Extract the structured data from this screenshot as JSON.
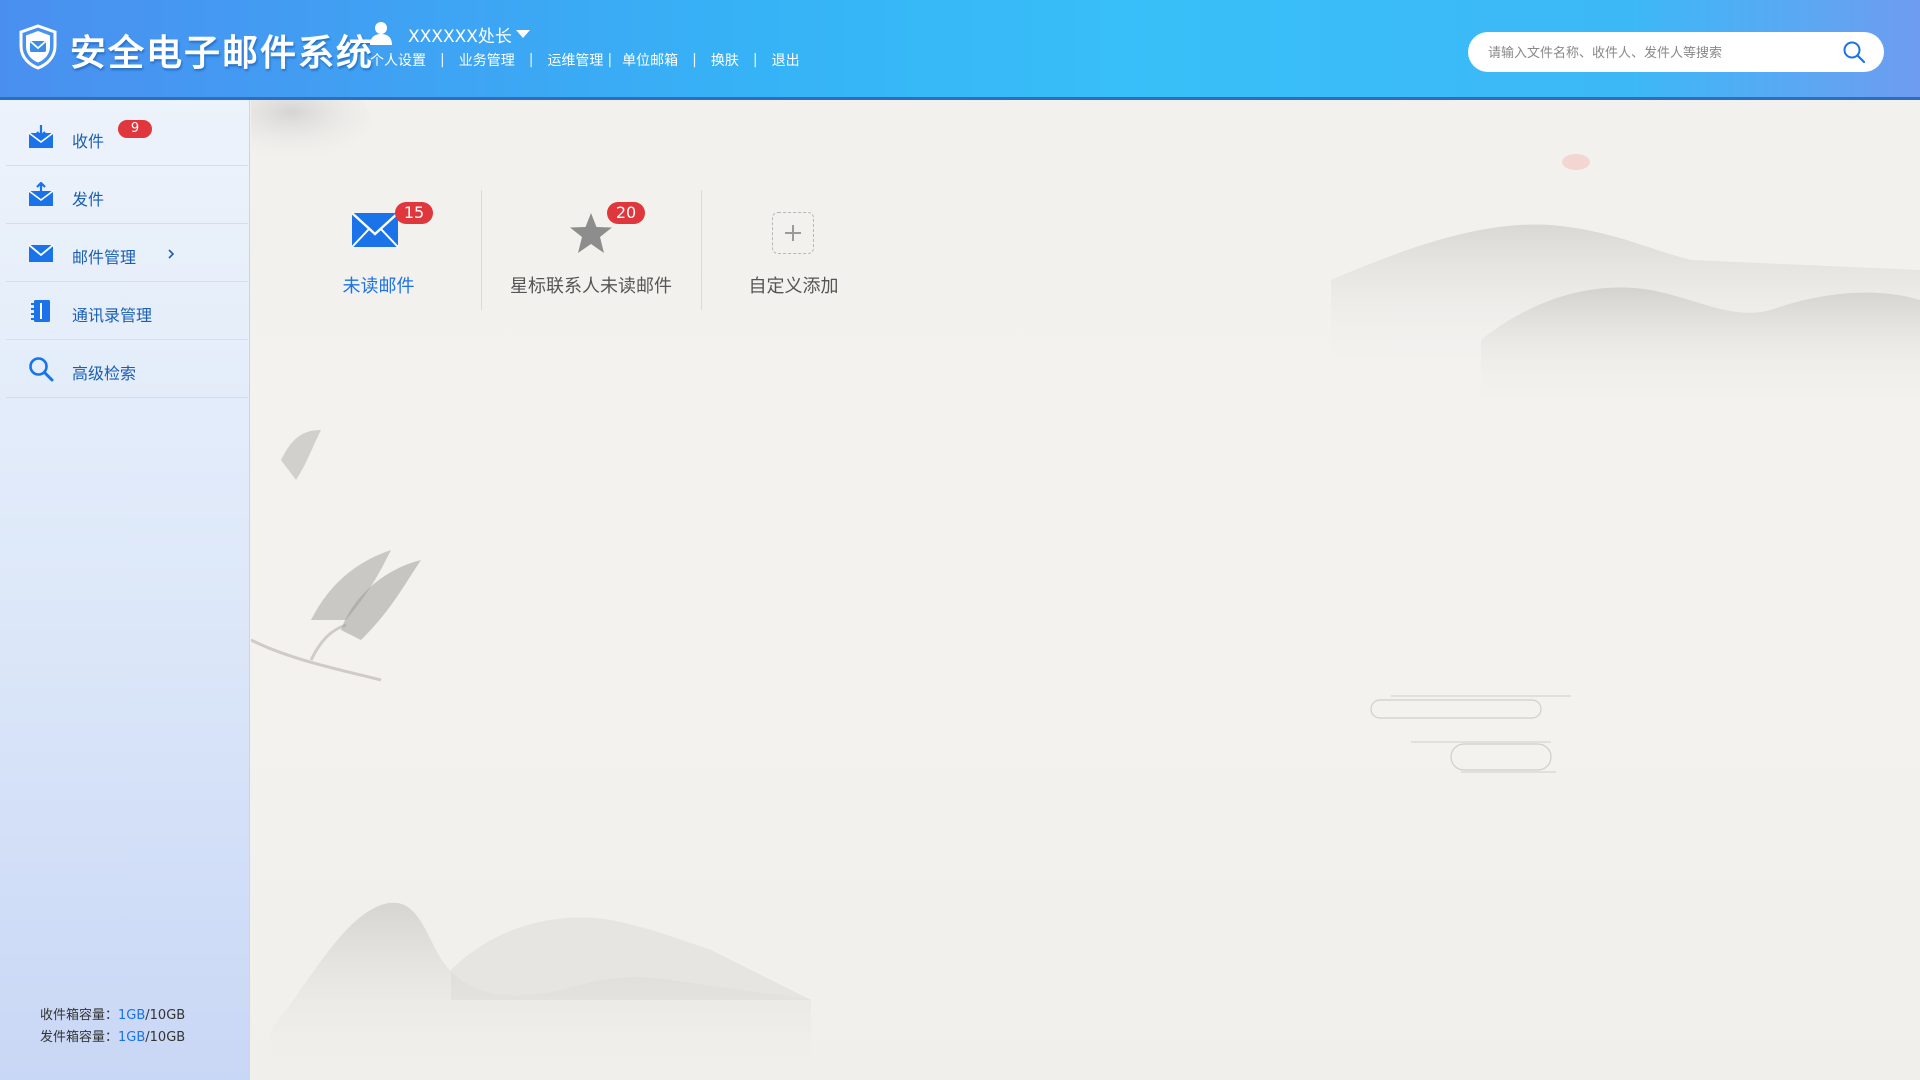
{
  "header": {
    "app_title": "安全电子邮件系统",
    "user_name": "XXXXXX处长",
    "links": [
      {
        "label": "个人设置",
        "sep": "|"
      },
      {
        "label": "业务管理",
        "sep": "|"
      },
      {
        "label": "运维管理",
        "sep": "|"
      },
      {
        "label": "单位邮箱",
        "sep": "|"
      },
      {
        "label": "换肤",
        "sep": "|"
      },
      {
        "label": "退出",
        "sep": ""
      }
    ],
    "search_placeholder": "请输入文件名称、收件人、发件人等搜索"
  },
  "sidebar": {
    "items": [
      {
        "label": "收件",
        "icon": "inbox-icon",
        "badge": "9"
      },
      {
        "label": "发件",
        "icon": "outbox-icon"
      },
      {
        "label": "邮件管理",
        "icon": "mail-manage-icon",
        "chevron": "chevron-right-icon"
      },
      {
        "label": "通讯录管理",
        "icon": "address-book-icon"
      },
      {
        "label": "高级检索",
        "icon": "search-icon"
      }
    ],
    "quota": {
      "inbox_label": "收件箱容量：",
      "inbox_used": "1GB",
      "inbox_total": "/10GB",
      "outbox_label": "发件箱容量：",
      "outbox_used": "1GB",
      "outbox_total": "/10GB"
    }
  },
  "widgets": [
    {
      "label": "未读邮件",
      "badge": "15",
      "icon": "envelope-icon",
      "label_color": "#1a73e8"
    },
    {
      "label": "星标联系人未读邮件",
      "badge": "20",
      "icon": "star-icon",
      "label_color": "#555555"
    },
    {
      "label": "自定义添加",
      "icon": "plus-icon",
      "label_color": "#555555"
    }
  ],
  "colors": {
    "accent": "#1a73e8",
    "badge": "#e0373c",
    "header_start": "#4a8ff0",
    "header_mid": "#38bff8"
  }
}
